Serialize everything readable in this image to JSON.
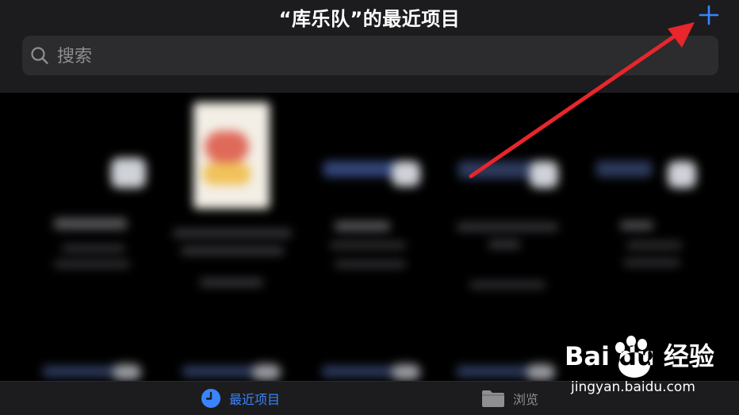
{
  "header": {
    "title": "“库乐队”的最近项目",
    "add_icon": "plus-icon"
  },
  "search": {
    "placeholder": "搜索",
    "value": ""
  },
  "tabbar": {
    "tabs": [
      {
        "label": "最近项目",
        "icon": "clock-icon",
        "active": true
      },
      {
        "label": "浏览",
        "icon": "folder-icon",
        "active": false
      }
    ]
  },
  "watermark": {
    "brand": "Bai du 经验",
    "url": "jingyan.baidu.com"
  },
  "colors": {
    "accent": "#3a84ff",
    "arrow": "#e8262b",
    "header_bg": "#1c1c1e",
    "search_bg": "#2c2c2e"
  }
}
